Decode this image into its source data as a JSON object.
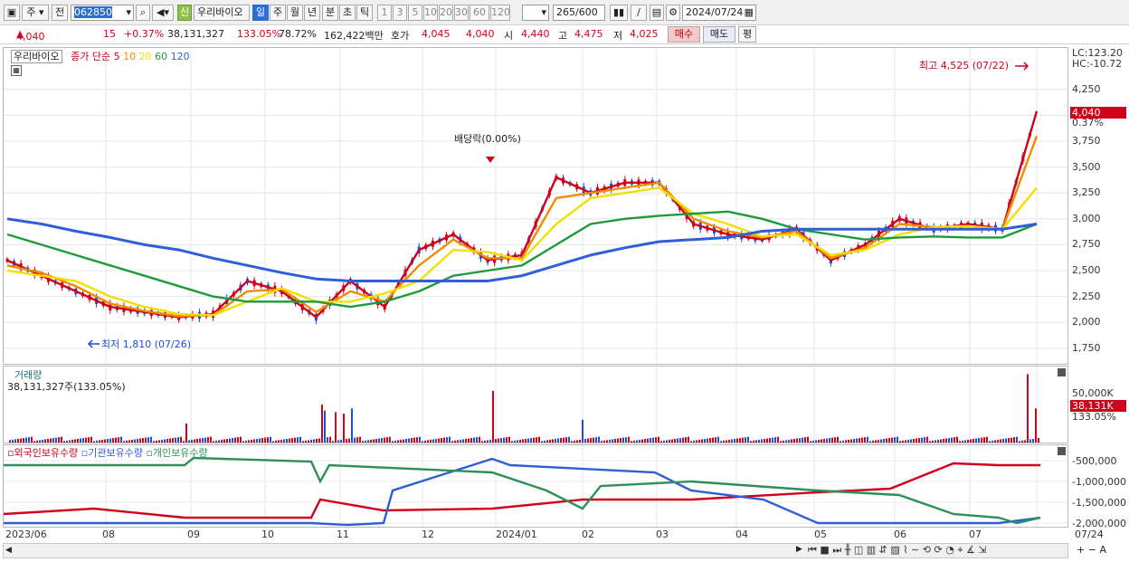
{
  "toolbar": {
    "type1": "주",
    "type2": "전",
    "code": "062850",
    "badge": "신",
    "name": "우리바이오",
    "periods": [
      "일",
      "주",
      "월",
      "년",
      "분",
      "초",
      "틱"
    ],
    "active_period": "일",
    "minute_steps": [
      "1",
      "3",
      "5",
      "10",
      "20",
      "30",
      "60",
      "120"
    ],
    "count": "265",
    "count_total": "/600",
    "date": "2024/07/24"
  },
  "info": {
    "price": "4,040",
    "change": "15",
    "change_pct": "+0.37%",
    "volume": "38,131,327",
    "vol_ratio": "133.05%",
    "turnover_pct": "78.72%",
    "amount": "162,422백만",
    "quote_label": "호가",
    "ask": "4,045",
    "bid": "4,040",
    "open_label": "시",
    "open": "4,440",
    "high_label": "고",
    "high": "4,475",
    "low_label": "저",
    "low": "4,025",
    "buy": "매수",
    "sell": "매도",
    "eval": "평"
  },
  "legend": {
    "stock": "우리바이오",
    "ma_label": "종가 단순",
    "ma": [
      {
        "period": "5",
        "color": "#d0021b"
      },
      {
        "period": "10",
        "color": "#f08c00"
      },
      {
        "period": "20",
        "color": "#f0e000"
      },
      {
        "period": "60",
        "color": "#1f9a3a"
      },
      {
        "period": "120",
        "color": "#2e5fd8"
      }
    ]
  },
  "annotations": {
    "high": "최고 4,525 (07/22)",
    "low": "최저 1,810 (07/26)",
    "dividend": "배당락(0.00%)",
    "lc": "LC:123.20",
    "hc": "HC:-10.72",
    "cur_price": "4,040",
    "cur_pct": "0.37%"
  },
  "volume_panel": {
    "title": "거래량",
    "summary": "38,131,327주(133.05%)",
    "axis_label": "50,000K",
    "cur": "38,131K",
    "cur_pct": "133.05%"
  },
  "holdings_panel": {
    "series": [
      {
        "name": "외국인보유수량",
        "color": "#d0021b"
      },
      {
        "name": "기관보유수량",
        "color": "#2e5fd8"
      },
      {
        "name": "개인보유수량",
        "color": "#2f8f5a"
      }
    ],
    "ticks": [
      "-500,000",
      "-1,000,000",
      "-1,500,000",
      "-2,000,000"
    ]
  },
  "chart_data": {
    "type": "line",
    "title": "우리바이오",
    "y_ticks": [
      1750,
      2000,
      2250,
      2500,
      2750,
      3000,
      3250,
      3500,
      3750,
      4000,
      4250
    ],
    "ylim": [
      1600,
      4650
    ],
    "x_ticks": [
      "2023/06",
      "08",
      "09",
      "10",
      "11",
      "12",
      "2024/01",
      "02",
      "03",
      "04",
      "05",
      "06",
      "07",
      "07/24"
    ],
    "series": [
      {
        "name": "5",
        "values": [
          2600,
          2450,
          2300,
          2150,
          2100,
          2050,
          2080,
          2400,
          2300,
          2050,
          2400,
          2150,
          2700,
          2850,
          2600,
          2650,
          3400,
          3250,
          3350,
          3350,
          2950,
          2850,
          2800,
          2900,
          2600,
          2750,
          3000,
          2900,
          2950,
          2900,
          4040
        ]
      },
      {
        "name": "10",
        "values": [
          2550,
          2480,
          2350,
          2180,
          2110,
          2060,
          2070,
          2300,
          2320,
          2100,
          2300,
          2200,
          2550,
          2800,
          2620,
          2620,
          3200,
          3250,
          3300,
          3350,
          3000,
          2880,
          2820,
          2880,
          2620,
          2720,
          2950,
          2920,
          2930,
          2900,
          3800
        ]
      },
      {
        "name": "20",
        "values": [
          2500,
          2450,
          2400,
          2250,
          2150,
          2080,
          2070,
          2200,
          2330,
          2200,
          2200,
          2280,
          2400,
          2700,
          2680,
          2600,
          2950,
          3200,
          3250,
          3300,
          3050,
          2950,
          2830,
          2850,
          2650,
          2700,
          2850,
          2920,
          2930,
          2900,
          3300
        ]
      },
      {
        "name": "60",
        "values": [
          2850,
          2750,
          2650,
          2550,
          2450,
          2350,
          2250,
          2200,
          2200,
          2200,
          2150,
          2200,
          2300,
          2450,
          2500,
          2550,
          2750,
          2950,
          3000,
          3030,
          3050,
          3070,
          3000,
          2900,
          2850,
          2800,
          2820,
          2830,
          2820,
          2820,
          2950
        ]
      },
      {
        "name": "120",
        "values": [
          3000,
          2950,
          2880,
          2820,
          2750,
          2700,
          2620,
          2550,
          2480,
          2420,
          2400,
          2400,
          2400,
          2400,
          2400,
          2450,
          2550,
          2650,
          2720,
          2780,
          2800,
          2820,
          2880,
          2900,
          2900,
          2900,
          2900,
          2900,
          2900,
          2900,
          2950
        ]
      }
    ]
  }
}
